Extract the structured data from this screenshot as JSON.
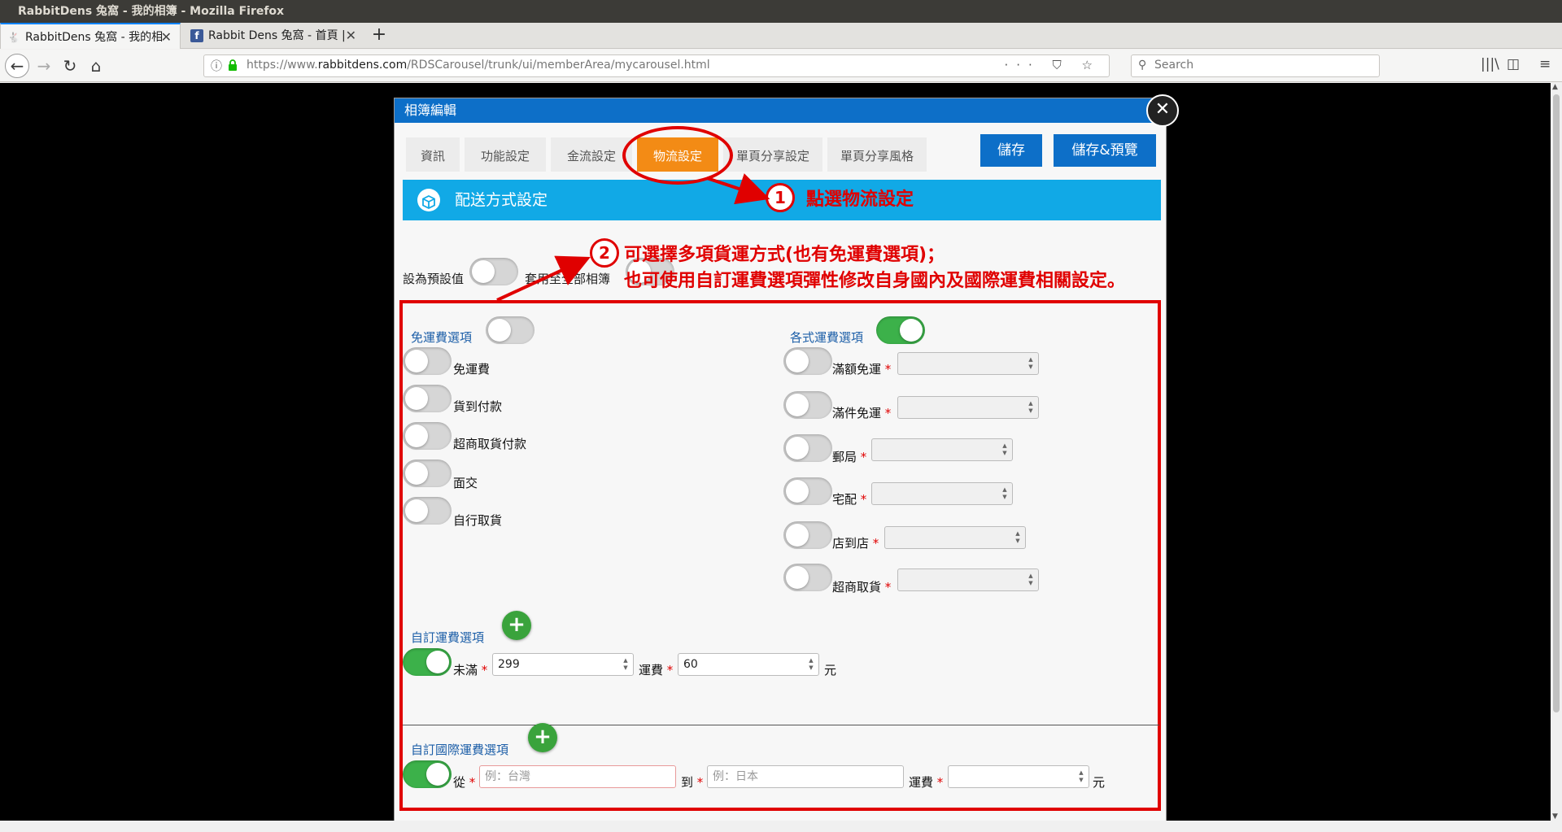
{
  "window": {
    "title": "RabbitDens 兔窩 - 我的相簿 - Mozilla Firefox"
  },
  "tabs": [
    {
      "label": "RabbitDens 兔窩 - 我的相",
      "icon": "rabbit-icon"
    },
    {
      "label": "Rabbit Dens 兔窩 - 首頁 |",
      "icon": "facebook-icon"
    }
  ],
  "nav": {
    "url_prefix": "https://www.",
    "url_domain": "rabbitdens.com",
    "url_path": "/RDSCarousel/trunk/ui/memberArea/mycarousel.html",
    "search_placeholder": "Search"
  },
  "modal": {
    "title": "相簿編輯",
    "tabs": [
      "資訊",
      "功能設定",
      "金流設定",
      "物流設定",
      "單頁分享設定",
      "單頁分享風格"
    ],
    "active_tab": "物流設定",
    "save_label": "儲存",
    "save_preview_label": "儲存&預覽",
    "section_title": "配送方式設定",
    "default_label": "設為預設值",
    "apply_all_label": "套用至全部相簿",
    "free_shipping": {
      "label": "免運費選項",
      "options": [
        "免運費",
        "貨到付款",
        "超商取貨付款",
        "面交",
        "自行取貨"
      ]
    },
    "shipping_options": {
      "label": "各式運費選項",
      "options": [
        "滿額免運",
        "滿件免運",
        "郵局",
        "宅配",
        "店到店",
        "超商取貨"
      ]
    },
    "custom_shipping": {
      "label": "自訂運費選項",
      "under_label": "未滿",
      "under_value": "299",
      "fee_label": "運費",
      "fee_value": "60",
      "unit": "元"
    },
    "custom_intl_shipping": {
      "label": "自訂國際運費選項",
      "from_label": "從",
      "from_placeholder": "例：台灣",
      "to_label": "到",
      "to_placeholder": "例：日本",
      "fee_label": "運費",
      "unit": "元"
    }
  },
  "annotations": {
    "step1_num": "1",
    "step1_text": "點選物流設定",
    "step2_num": "2",
    "step2_line1": "可選擇多項貨運方式(也有免運費選項)；",
    "step2_line2": "也可使用自訂運費選項彈性修改自身國內及國際運費相關設定。"
  },
  "colors": {
    "accent_blue": "#0d6fc8",
    "section_blue": "#11a9e6",
    "active_tab_orange": "#f38b15",
    "toggle_green": "#3cb14a",
    "annotation_red": "#e00000"
  }
}
